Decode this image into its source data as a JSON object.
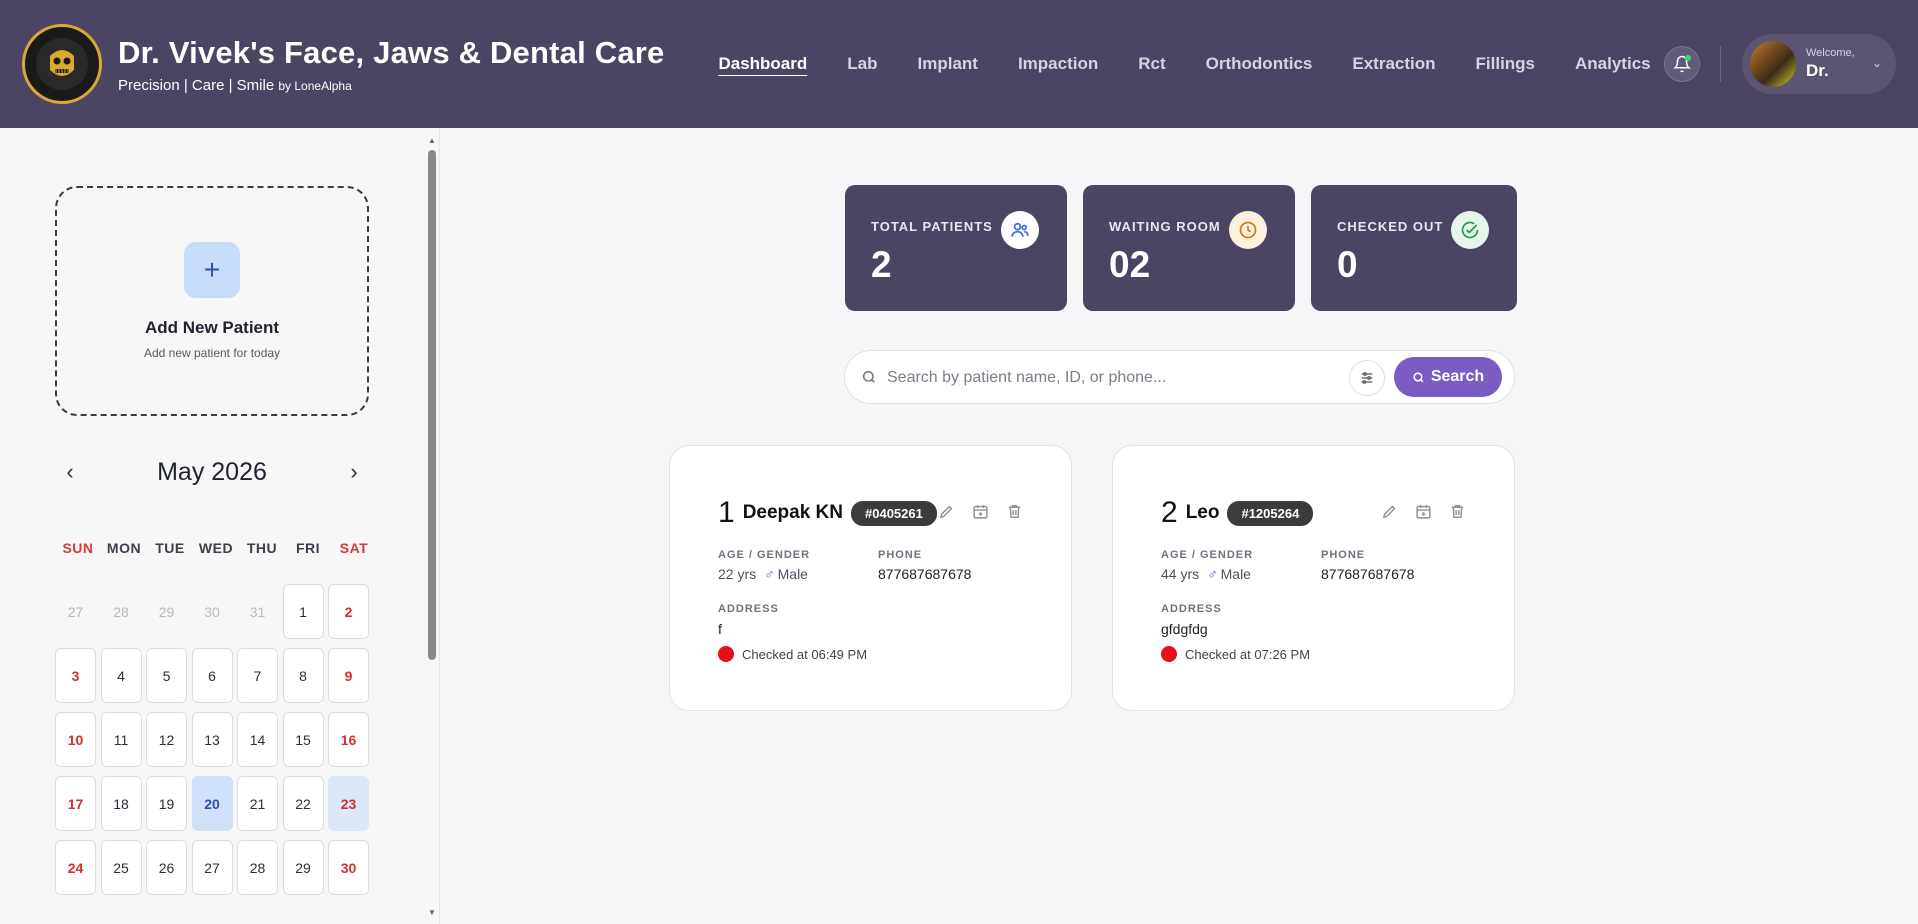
{
  "header": {
    "title": "Dr. Vivek's Face, Jaws & Dental Care",
    "subtitle": "Precision | Care | Smile",
    "byline": "by LoneAlpha",
    "nav": [
      {
        "label": "Dashboard",
        "active": true
      },
      {
        "label": "Lab"
      },
      {
        "label": "Implant"
      },
      {
        "label": "Impaction"
      },
      {
        "label": "Rct"
      },
      {
        "label": "Orthodontics"
      },
      {
        "label": "Extraction"
      },
      {
        "label": "Fillings"
      },
      {
        "label": "Analytics"
      }
    ],
    "user": {
      "welcome": "Welcome,",
      "name": "Dr."
    }
  },
  "sidebar": {
    "add_title": "Add New Patient",
    "add_sub": "Add new patient for today",
    "add_symbol": "+",
    "calendar": {
      "month": "May 2026",
      "days_of_week": [
        "SUN",
        "MON",
        "TUE",
        "WED",
        "THU",
        "FRI",
        "SAT"
      ],
      "leading": [
        "27",
        "28",
        "29",
        "30",
        "31"
      ],
      "days": [
        "1",
        "2",
        "3",
        "4",
        "5",
        "6",
        "7",
        "8",
        "9",
        "10",
        "11",
        "12",
        "13",
        "14",
        "15",
        "16",
        "17",
        "18",
        "19",
        "20",
        "21",
        "22",
        "23",
        "24",
        "25",
        "26",
        "27",
        "28",
        "29",
        "30"
      ],
      "selected": [
        "20",
        "23"
      ]
    }
  },
  "stats": {
    "total": {
      "label": "TOTAL PATIENTS",
      "value": "2"
    },
    "waiting": {
      "label": "WAITING ROOM",
      "value": "02"
    },
    "checked": {
      "label": "CHECKED OUT",
      "value": "0"
    }
  },
  "search": {
    "placeholder": "Search by patient name, ID, or phone...",
    "button": "Search"
  },
  "patients": [
    {
      "num": "1",
      "name": "Deepak KN",
      "id": "#0405261",
      "age_label": "AGE / GENDER",
      "age": "22 yrs",
      "gender": "Male",
      "phone_label": "PHONE",
      "phone": "877687687678",
      "address_label": "ADDRESS",
      "address": "f",
      "status": "Checked at 06:49 PM"
    },
    {
      "num": "2",
      "name": "Leo",
      "id": "#1205264",
      "age_label": "AGE / GENDER",
      "age": "44 yrs",
      "gender": "Male",
      "phone_label": "PHONE",
      "phone": "877687687678",
      "address_label": "ADDRESS",
      "address": "gfdgfdg",
      "status": "Checked at 07:26 PM"
    }
  ],
  "colors": {
    "header_bg": "#4b4563",
    "accent": "#7b5bc4",
    "weekend": "#d53a3a",
    "status_red": "#e5101c"
  }
}
